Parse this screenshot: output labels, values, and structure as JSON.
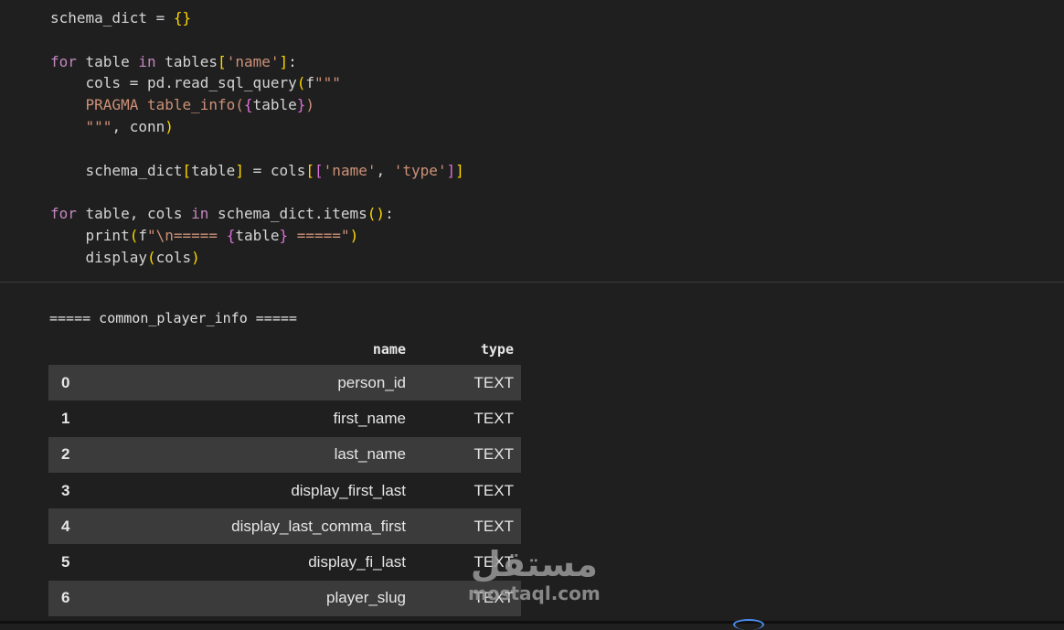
{
  "code": {
    "lines": [
      "schema_dict = {}",
      "",
      "for table in tables['name']:",
      "    cols = pd.read_sql_query(f\"\"\"",
      "    PRAGMA table_info({table})",
      "    \"\"\", conn)",
      "",
      "    schema_dict[table] = cols[['name', 'type']]",
      "",
      "for table, cols in schema_dict.items():",
      "    print(f\"\\n===== {table} =====\")",
      "    display(cols)"
    ]
  },
  "output": {
    "header": "===== common_player_info =====",
    "columns": [
      "name",
      "type"
    ],
    "rows": [
      {
        "index": "0",
        "name": "person_id",
        "type": "TEXT"
      },
      {
        "index": "1",
        "name": "first_name",
        "type": "TEXT"
      },
      {
        "index": "2",
        "name": "last_name",
        "type": "TEXT"
      },
      {
        "index": "3",
        "name": "display_first_last",
        "type": "TEXT"
      },
      {
        "index": "4",
        "name": "display_last_comma_first",
        "type": "TEXT"
      },
      {
        "index": "5",
        "name": "display_fi_last",
        "type": "TEXT"
      },
      {
        "index": "6",
        "name": "player_slug",
        "type": "TEXT"
      }
    ]
  },
  "watermark": {
    "arabic": "مستقل",
    "latin": "mostaql.com"
  }
}
